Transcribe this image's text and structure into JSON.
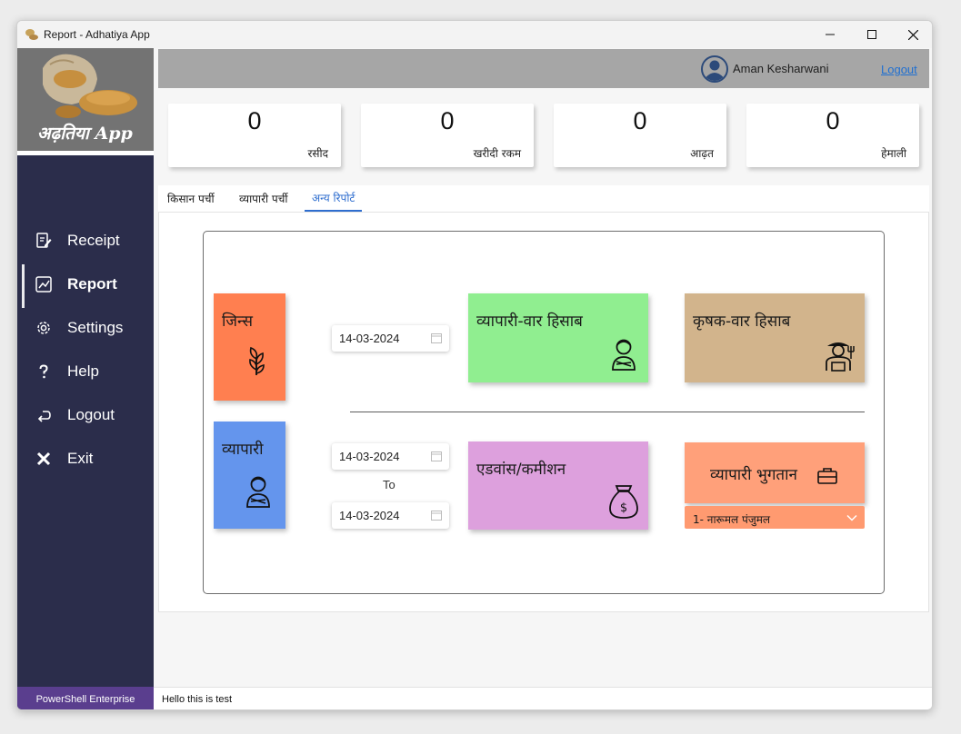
{
  "window": {
    "title": "Report - Adhatiya App"
  },
  "sidebar": {
    "logo_text": "अढ़तिया App",
    "items": [
      {
        "label": "Receipt",
        "icon": "receipt-icon"
      },
      {
        "label": "Report",
        "icon": "chart-icon"
      },
      {
        "label": "Settings",
        "icon": "gear-icon"
      },
      {
        "label": "Help",
        "icon": "question-icon"
      },
      {
        "label": "Logout",
        "icon": "logout-icon"
      },
      {
        "label": "Exit",
        "icon": "close-icon"
      }
    ],
    "footer": "PowerShell Enterprise"
  },
  "header": {
    "user_name": "Aman Kesharwani",
    "logout_label": "Logout"
  },
  "stats": [
    {
      "value": "0",
      "label": "रसीद"
    },
    {
      "value": "0",
      "label": "खरीदी रकम"
    },
    {
      "value": "0",
      "label": "आढ़त"
    },
    {
      "value": "0",
      "label": "हेमाली"
    }
  ],
  "tabs": [
    {
      "label": "किसान पर्ची"
    },
    {
      "label": "व्यापारी पर्ची"
    },
    {
      "label": "अन्य रिपोर्ट",
      "active": true
    }
  ],
  "report": {
    "jins_label": "जिन्स",
    "vyapari_label": "व्यापारी",
    "date_single": "14-03-2024",
    "date_from": "14-03-2024",
    "to_label": "To",
    "date_to": "14-03-2024",
    "trader_wise_label": "व्यापारी-वार हिसाब",
    "farmer_wise_label": "कृषक-वार हिसाब",
    "advance_label": "एडवांस/कमीशन",
    "payment_label": "व्यापारी भुगतान",
    "trader_select_value": "1- नारूमल पंजुमल"
  },
  "colors": {
    "sidebar_bg": "#2b2d4b",
    "jins_tile": "#ff7f50",
    "vyapari_tile": "#6495ed",
    "trader_wise_tile": "#90ee90",
    "farmer_wise_tile": "#d2b48c",
    "advance_tile": "#dda0dd",
    "payment_tile": "#ffa07a"
  },
  "status": {
    "message": "Hello this is test"
  }
}
